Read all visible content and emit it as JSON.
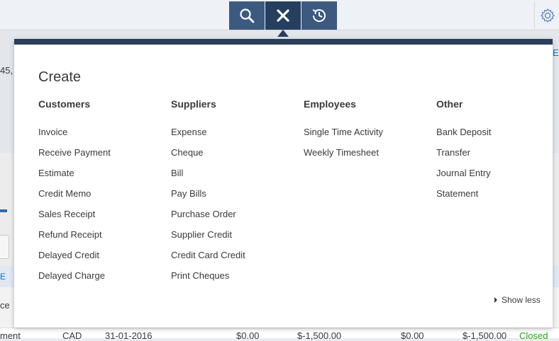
{
  "background": {
    "fragment_amount": "45,",
    "fragment_edit": "Ec",
    "fragment_e": "E",
    "fragment_ce": "ce",
    "row": {
      "type": "ment",
      "currency": "CAD",
      "date": "31-01-2016",
      "col1": "$0.00",
      "col2": "$-1,500.00",
      "col3": "$0.00",
      "col4": "$-1,500.00",
      "status": "Closed"
    }
  },
  "toolbar": {
    "search_icon": "search-icon",
    "close_icon": "close-icon",
    "recent_icon": "history-icon",
    "settings_icon": "gear-icon"
  },
  "create": {
    "title": "Create",
    "columns": [
      {
        "heading": "Customers",
        "items": [
          "Invoice",
          "Receive Payment",
          "Estimate",
          "Credit Memo",
          "Sales Receipt",
          "Refund Receipt",
          "Delayed Credit",
          "Delayed Charge"
        ]
      },
      {
        "heading": "Suppliers",
        "items": [
          "Expense",
          "Cheque",
          "Bill",
          "Pay Bills",
          "Purchase Order",
          "Supplier Credit",
          "Credit Card Credit",
          "Print Cheques"
        ]
      },
      {
        "heading": "Employees",
        "items": [
          "Single Time Activity",
          "Weekly Timesheet"
        ]
      },
      {
        "heading": "Other",
        "items": [
          "Bank Deposit",
          "Transfer",
          "Journal Entry",
          "Statement"
        ]
      }
    ],
    "show_less": "Show less"
  },
  "colors": {
    "navy": "#263f5f",
    "toolbar_blue": "#3b5a80",
    "closed_green": "#2ca01c"
  }
}
